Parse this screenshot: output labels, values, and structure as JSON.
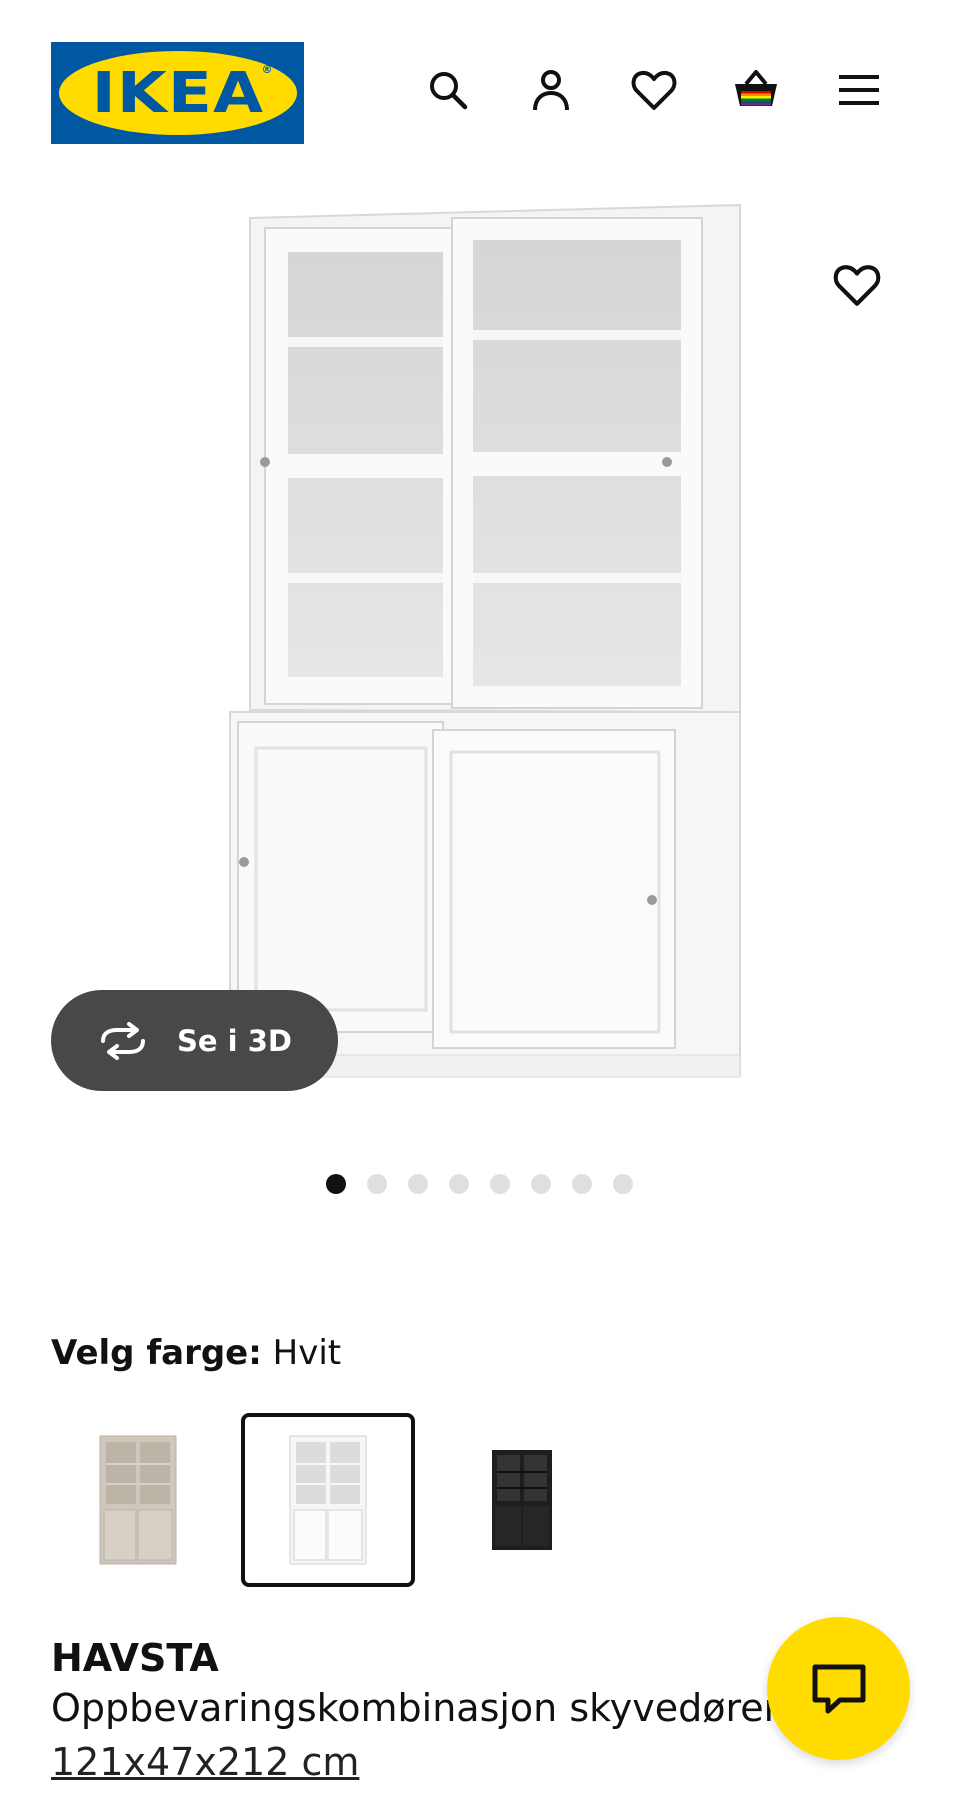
{
  "header": {
    "logo_text": "IKEA",
    "logo_mark": "®",
    "icons": [
      "search-icon",
      "account-icon",
      "heart-icon",
      "basket-icon",
      "menu-icon"
    ]
  },
  "gallery": {
    "view_3d_label": "Se i 3D",
    "image_count": 8,
    "active_index": 0
  },
  "color": {
    "label": "Velg farge:",
    "value": "Hvit",
    "options": [
      "Grå-beige",
      "Hvit",
      "Svart"
    ],
    "selected_index": 1
  },
  "product": {
    "name": "HAVSTA",
    "description": "Oppbevaringskombinasjon skyvedører",
    "size": "121x47x212 cm"
  },
  "colors": {
    "brand_blue": "#0058a3",
    "brand_yellow": "#ffdb00",
    "button_dark": "#484848"
  }
}
